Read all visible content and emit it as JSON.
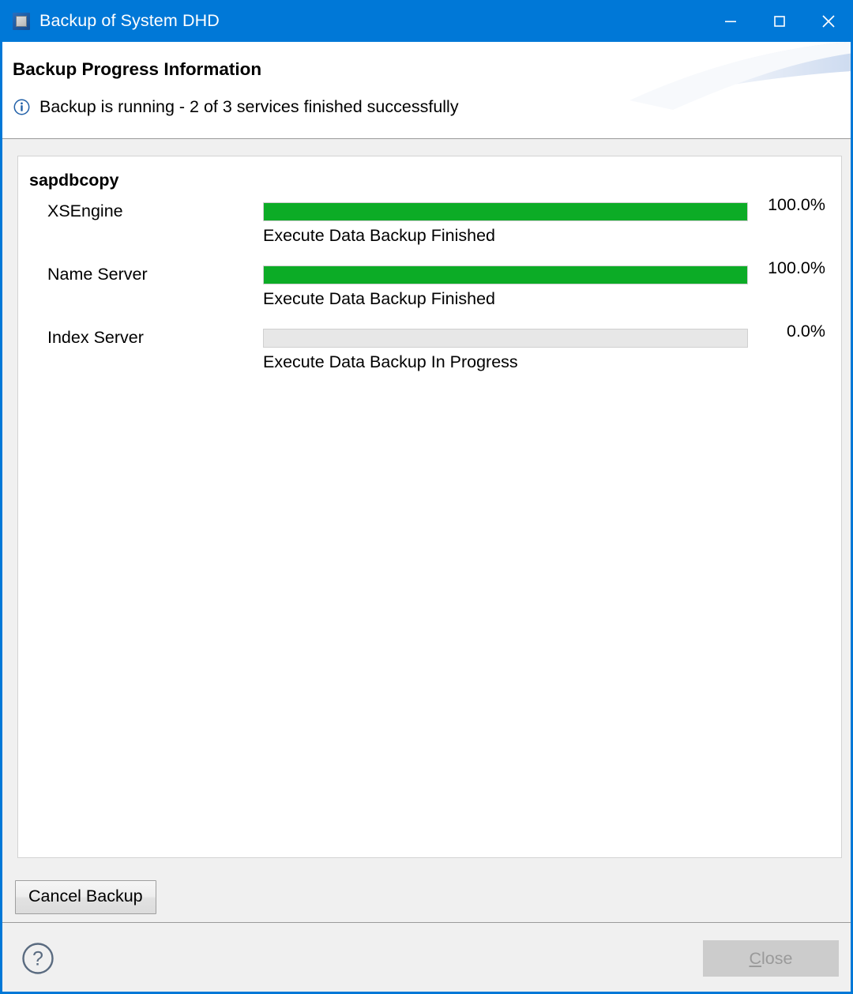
{
  "window": {
    "title": "Backup of System DHD",
    "icon": "application-window-icon",
    "accent_color": "#0078d7",
    "controls": {
      "minimize": "minimize-icon",
      "maximize": "maximize-icon",
      "close": "close-icon"
    }
  },
  "header": {
    "title": "Backup Progress Information",
    "status_icon": "info-icon",
    "status_text": "Backup is running - 2 of 3 services finished successfully"
  },
  "content": {
    "group_label": "sapdbcopy",
    "services": [
      {
        "name": "XSEngine",
        "percent_label": "100.0%",
        "percent_value": 100,
        "status": "Execute Data Backup Finished",
        "bar_color": "#0cac26"
      },
      {
        "name": "Name Server",
        "percent_label": "100.0%",
        "percent_value": 100,
        "status": "Execute Data Backup Finished",
        "bar_color": "#0cac26"
      },
      {
        "name": "Index Server",
        "percent_label": "0.0%",
        "percent_value": 0,
        "status": "Execute Data Backup In Progress",
        "bar_color": "#0cac26"
      }
    ]
  },
  "actions": {
    "cancel_backup_label": "Cancel Backup"
  },
  "footer": {
    "help_icon": "help-icon",
    "close_label_prefix": "",
    "close_mnemonic": "C",
    "close_label_rest": "lose",
    "close_label": "Close",
    "close_enabled": false
  }
}
